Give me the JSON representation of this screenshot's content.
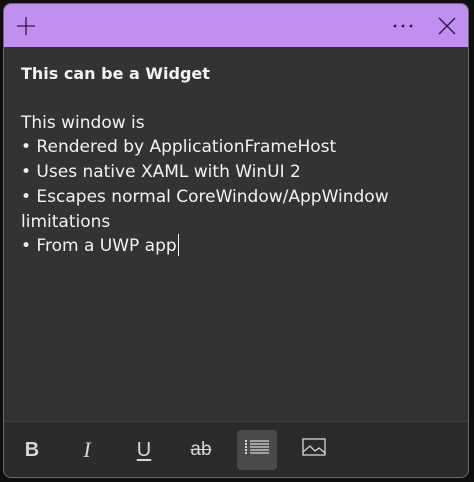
{
  "titlebar": {
    "color": "#c08ff0",
    "add_icon": "plus-icon",
    "more_icon": "more-horizontal-icon",
    "close_icon": "close-icon"
  },
  "note": {
    "title": "This can be a Widget",
    "lines": [
      "This window is",
      "• Rendered by ApplicationFrameHost",
      "• Uses native XAML with WinUI 2",
      "• Escapes normal CoreWindow/AppWindow",
      "limitations",
      "• From a UWP app"
    ]
  },
  "toolbar": {
    "bold_label": "B",
    "italic_label": "I",
    "underline_label": "U",
    "strike_label": "ab",
    "list_icon": "bulleted-list-icon",
    "image_icon": "image-icon",
    "active_tool": "bulleted-list"
  }
}
